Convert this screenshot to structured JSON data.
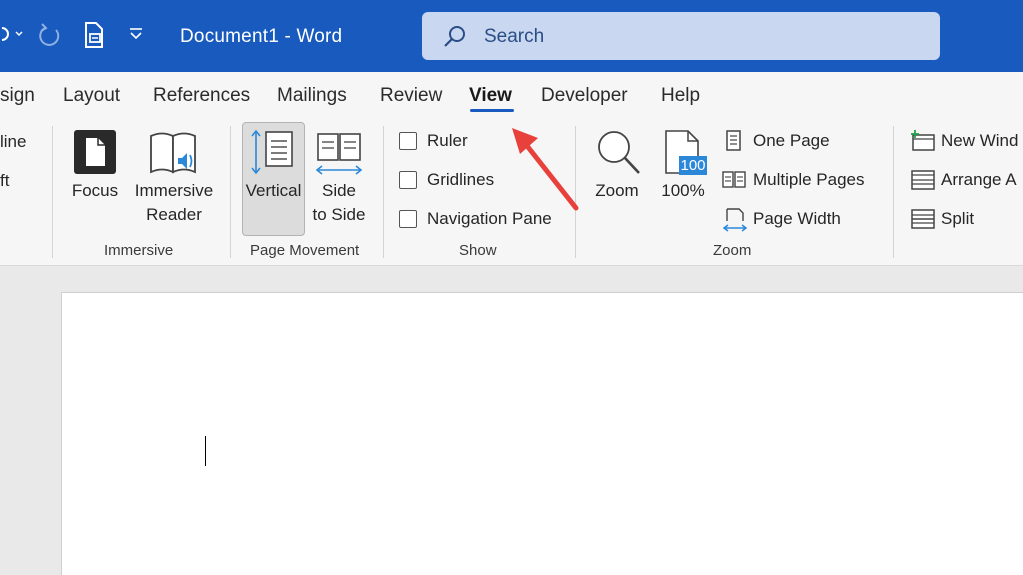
{
  "titlebar": {
    "doc_title": "Document1  -  Word",
    "search_placeholder": "Search",
    "quick_access": [
      "redo-icon",
      "save-print-icon",
      "customize-dropdown-icon"
    ]
  },
  "tabs": [
    {
      "label": "sign"
    },
    {
      "label": "Layout"
    },
    {
      "label": "References"
    },
    {
      "label": "Mailings"
    },
    {
      "label": "Review"
    },
    {
      "label": "View",
      "active": true
    },
    {
      "label": "Developer"
    },
    {
      "label": "Help"
    }
  ],
  "ribbon": {
    "partial": {
      "line1": "line",
      "line2": "ft"
    },
    "immersive": {
      "group": "Immersive",
      "focus": "Focus",
      "immersive_reader_1": "Immersive",
      "immersive_reader_2": "Reader"
    },
    "page_movement": {
      "group": "Page Movement",
      "vertical": "Vertical",
      "side_1": "Side",
      "side_2": "to Side"
    },
    "show": {
      "group": "Show",
      "ruler": "Ruler",
      "gridlines": "Gridlines",
      "navigation_pane": "Navigation Pane"
    },
    "zoom": {
      "group": "Zoom",
      "zoom": "Zoom",
      "hundred": "100%",
      "hundred_badge": "100",
      "one_page": "One Page",
      "multiple_pages": "Multiple Pages",
      "page_width": "Page Width"
    },
    "window": {
      "new_window": "New Wind",
      "arrange_all": "Arrange A",
      "split": "Split"
    }
  },
  "colors": {
    "titlebar": "#185abd",
    "accent_arrow": "#e8413c",
    "search_bg": "#c9d8f0"
  }
}
